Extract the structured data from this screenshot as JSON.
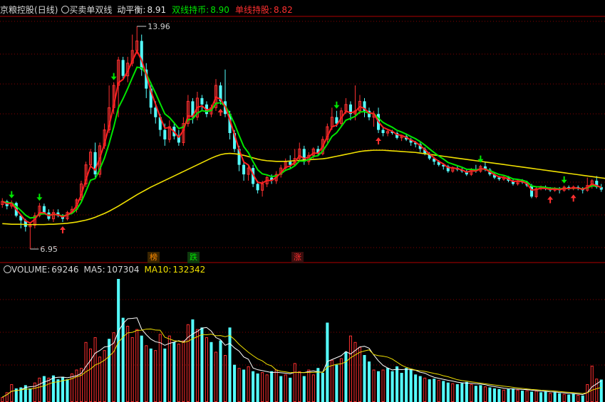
{
  "main_panel": {
    "stock_name": "京粮控股",
    "period": "(日线)",
    "indicator_name": "买卖单双线",
    "items": [
      {
        "label": "动平衡:",
        "value": "8.91",
        "label_color": "#e6e6e6",
        "value_color": "#e6e6e6"
      },
      {
        "label": "双线持币:",
        "value": "8.90",
        "label_color": "#00e600",
        "value_color": "#00e600"
      },
      {
        "label": "单线持股:",
        "value": "8.82",
        "label_color": "#ff3030",
        "value_color": "#ff3030"
      }
    ],
    "high_label": "13.96",
    "low_label": "6.95"
  },
  "badges": [
    {
      "text": "榜",
      "color": "#ff8c00",
      "bg": "#3a2400"
    },
    {
      "text": "跌",
      "color": "#00e600",
      "bg": "#0d3a0d"
    },
    {
      "text": "涨",
      "color": "#ff3030",
      "bg": "#3a0d0d"
    }
  ],
  "volume_panel": {
    "items": [
      {
        "label": "VOLUME:",
        "value": "69246",
        "color": "#d6d6d6"
      },
      {
        "label": "MA5:",
        "value": "107304",
        "color": "#d6d6d6"
      },
      {
        "label": "MA10:",
        "value": "132342",
        "color": "#f0e000"
      }
    ]
  },
  "colors": {
    "up": "#ff3030",
    "down": "#54ffff",
    "dual": "#00e600",
    "single": "#ff2020",
    "balance": "#f0e000",
    "grid": "#8a0000"
  },
  "chart_data": {
    "type": "candlestick",
    "price_range": [
      6.95,
      13.96
    ],
    "candles": [
      [
        8.35,
        8.45,
        8.55,
        8.25
      ],
      [
        8.45,
        8.3,
        8.5,
        8.2
      ],
      [
        8.3,
        8.4,
        8.48,
        8.22
      ],
      [
        8.4,
        8.0,
        8.44,
        7.95
      ],
      [
        8.0,
        7.85,
        8.05,
        7.6
      ],
      [
        7.85,
        7.65,
        7.9,
        7.5
      ],
      [
        7.65,
        7.7,
        7.8,
        6.95
      ],
      [
        7.7,
        8.0,
        8.1,
        7.6
      ],
      [
        8.0,
        8.3,
        8.4,
        7.95
      ],
      [
        8.3,
        8.1,
        8.38,
        8.05
      ],
      [
        8.1,
        7.9,
        8.2,
        7.85
      ],
      [
        7.9,
        8.1,
        8.2,
        7.8
      ],
      [
        8.1,
        8.0,
        8.2,
        7.95
      ],
      [
        8.0,
        7.9,
        8.05,
        7.8
      ],
      [
        7.9,
        8.1,
        8.15,
        7.85
      ],
      [
        8.1,
        8.2,
        8.3,
        8.05
      ],
      [
        8.2,
        8.5,
        8.55,
        8.1
      ],
      [
        8.5,
        9.0,
        9.1,
        8.4
      ],
      [
        9.0,
        9.6,
        9.7,
        8.9
      ],
      [
        9.6,
        10.0,
        10.1,
        9.5
      ],
      [
        10.0,
        9.3,
        10.3,
        9.2
      ],
      [
        9.3,
        10.2,
        10.3,
        9.2
      ],
      [
        10.2,
        10.7,
        10.9,
        10.1
      ],
      [
        10.7,
        11.4,
        12.1,
        10.6
      ],
      [
        11.4,
        12.1,
        12.2,
        11.2
      ],
      [
        12.1,
        12.9,
        13.0,
        11.1
      ],
      [
        12.9,
        12.4,
        13.0,
        12.3
      ],
      [
        12.4,
        12.8,
        13.0,
        12.2
      ],
      [
        12.8,
        13.2,
        13.7,
        12.7
      ],
      [
        13.2,
        13.5,
        13.96,
        13.1
      ],
      [
        13.5,
        12.6,
        13.7,
        12.4
      ],
      [
        12.6,
        12.0,
        12.8,
        11.7
      ],
      [
        12.0,
        11.4,
        12.2,
        11.2
      ],
      [
        11.4,
        11.1,
        11.6,
        10.9
      ],
      [
        11.1,
        10.7,
        11.2,
        10.5
      ],
      [
        10.7,
        10.4,
        10.9,
        10.2
      ],
      [
        10.4,
        10.8,
        11.0,
        10.3
      ],
      [
        10.8,
        10.5,
        10.9,
        10.4
      ],
      [
        10.5,
        10.3,
        10.7,
        10.2
      ],
      [
        10.3,
        10.9,
        11.1,
        10.2
      ],
      [
        10.9,
        11.6,
        11.8,
        10.8
      ],
      [
        11.6,
        11.1,
        11.7,
        10.9
      ],
      [
        11.1,
        11.7,
        11.9,
        11.0
      ],
      [
        11.7,
        11.5,
        11.8,
        11.3
      ],
      [
        11.5,
        11.2,
        11.6,
        11.1
      ],
      [
        11.2,
        11.4,
        11.5,
        11.1
      ],
      [
        11.4,
        12.1,
        12.3,
        11.3
      ],
      [
        12.1,
        11.6,
        12.2,
        11.5
      ],
      [
        11.6,
        11.2,
        12.6,
        11.1
      ],
      [
        11.2,
        10.6,
        11.3,
        10.4
      ],
      [
        10.6,
        10.1,
        10.7,
        10.0
      ],
      [
        10.1,
        9.6,
        10.2,
        9.4
      ],
      [
        9.6,
        9.3,
        9.7,
        9.1
      ],
      [
        9.3,
        9.5,
        9.6,
        9.1
      ],
      [
        9.5,
        9.0,
        9.6,
        8.9
      ],
      [
        9.0,
        8.8,
        9.1,
        8.7
      ],
      [
        8.8,
        9.0,
        9.1,
        8.6
      ],
      [
        9.0,
        9.2,
        9.25,
        8.9
      ],
      [
        9.2,
        9.1,
        9.3,
        9.0
      ],
      [
        9.1,
        9.3,
        9.4,
        9.0
      ],
      [
        9.3,
        9.5,
        9.6,
        9.2
      ],
      [
        9.5,
        9.7,
        9.8,
        9.4
      ],
      [
        9.7,
        9.6,
        9.9,
        9.5
      ],
      [
        9.6,
        9.8,
        10.1,
        9.55
      ],
      [
        9.8,
        10.1,
        10.3,
        9.7
      ],
      [
        10.1,
        9.7,
        10.2,
        9.6
      ],
      [
        9.7,
        9.9,
        10.0,
        9.6
      ],
      [
        9.9,
        10.1,
        10.15,
        9.8
      ],
      [
        10.1,
        9.95,
        10.2,
        9.9
      ],
      [
        9.95,
        10.4,
        10.5,
        9.9
      ],
      [
        10.4,
        10.8,
        10.9,
        10.3
      ],
      [
        10.8,
        11.1,
        11.4,
        10.7
      ],
      [
        11.1,
        10.9,
        11.3,
        10.8
      ],
      [
        10.9,
        11.3,
        11.4,
        10.8
      ],
      [
        11.3,
        11.5,
        11.7,
        11.2
      ],
      [
        11.5,
        11.2,
        11.6,
        11.0
      ],
      [
        11.2,
        11.3,
        12.1,
        11.0
      ],
      [
        11.3,
        11.6,
        11.8,
        11.2
      ],
      [
        11.6,
        11.3,
        11.7,
        11.1
      ],
      [
        11.3,
        11.1,
        11.4,
        11.0
      ],
      [
        11.1,
        11.2,
        11.3,
        10.8
      ],
      [
        11.2,
        10.7,
        11.4,
        10.6
      ],
      [
        10.7,
        10.6,
        10.8,
        10.5
      ],
      [
        10.6,
        10.65,
        10.7,
        10.5
      ],
      [
        10.65,
        10.6,
        10.7,
        10.55
      ],
      [
        10.6,
        10.45,
        10.65,
        10.4
      ],
      [
        10.45,
        10.5,
        10.55,
        10.35
      ],
      [
        10.5,
        10.4,
        10.55,
        10.35
      ],
      [
        10.4,
        10.3,
        10.45,
        10.2
      ],
      [
        10.3,
        10.25,
        10.35,
        10.15
      ],
      [
        10.25,
        10.1,
        10.3,
        10.0
      ],
      [
        10.1,
        9.95,
        10.15,
        9.9
      ],
      [
        9.95,
        9.8,
        10.0,
        9.75
      ],
      [
        9.8,
        9.7,
        9.85,
        9.6
      ],
      [
        9.7,
        9.6,
        9.75,
        9.55
      ],
      [
        9.6,
        9.55,
        9.65,
        9.45
      ],
      [
        9.55,
        9.4,
        9.6,
        9.35
      ],
      [
        9.4,
        9.5,
        9.55,
        9.35
      ],
      [
        9.5,
        9.45,
        9.55,
        9.4
      ],
      [
        9.45,
        9.4,
        9.5,
        9.35
      ],
      [
        9.4,
        9.3,
        9.45,
        9.25
      ],
      [
        9.3,
        9.45,
        9.5,
        9.25
      ],
      [
        9.45,
        9.4,
        9.6,
        9.35
      ],
      [
        9.4,
        9.55,
        9.6,
        9.35
      ],
      [
        9.55,
        9.45,
        9.7,
        9.4
      ],
      [
        9.45,
        9.3,
        9.5,
        9.25
      ],
      [
        9.3,
        9.2,
        9.35,
        9.15
      ],
      [
        9.2,
        9.15,
        9.25,
        9.1
      ],
      [
        9.15,
        9.2,
        9.25,
        9.1
      ],
      [
        9.2,
        9.1,
        9.25,
        9.05
      ],
      [
        9.1,
        9.0,
        9.15,
        8.95
      ],
      [
        9.0,
        9.1,
        9.15,
        8.95
      ],
      [
        9.1,
        9.05,
        9.15,
        9.0
      ],
      [
        9.05,
        8.95,
        9.1,
        8.9
      ],
      [
        8.95,
        8.6,
        9.0,
        8.55
      ],
      [
        8.6,
        8.85,
        8.9,
        8.55
      ],
      [
        8.85,
        8.9,
        8.95,
        8.8
      ],
      [
        8.9,
        8.85,
        8.95,
        8.8
      ],
      [
        8.85,
        8.8,
        8.9,
        8.75
      ],
      [
        8.8,
        8.85,
        8.9,
        8.75
      ],
      [
        8.85,
        8.8,
        8.9,
        8.7
      ],
      [
        8.8,
        8.9,
        8.95,
        8.75
      ],
      [
        8.9,
        8.85,
        8.95,
        8.8
      ],
      [
        8.85,
        8.9,
        8.95,
        8.8
      ],
      [
        8.9,
        8.85,
        8.95,
        8.8
      ],
      [
        8.85,
        8.8,
        8.9,
        8.7
      ],
      [
        8.8,
        8.95,
        9.2,
        8.75
      ],
      [
        8.95,
        9.1,
        9.15,
        8.85
      ],
      [
        9.1,
        8.9,
        9.25,
        8.85
      ],
      [
        8.9,
        8.82,
        9.0,
        8.75
      ]
    ],
    "balance_line": [
      7.75,
      7.74,
      7.73,
      7.73,
      7.73,
      7.72,
      7.72,
      7.72,
      7.72,
      7.72,
      7.73,
      7.73,
      7.74,
      7.75,
      7.76,
      7.78,
      7.8,
      7.83,
      7.86,
      7.9,
      7.95,
      8.01,
      8.07,
      8.14,
      8.22,
      8.3,
      8.39,
      8.48,
      8.57,
      8.66,
      8.74,
      8.82,
      8.9,
      8.97,
      9.04,
      9.11,
      9.18,
      9.25,
      9.32,
      9.39,
      9.46,
      9.53,
      9.6,
      9.67,
      9.74,
      9.81,
      9.87,
      9.92,
      9.95,
      9.96,
      9.95,
      9.93,
      9.9,
      9.86,
      9.82,
      9.78,
      9.75,
      9.73,
      9.72,
      9.71,
      9.71,
      9.71,
      9.72,
      9.73,
      9.74,
      9.75,
      9.76,
      9.77,
      9.78,
      9.79,
      9.81,
      9.84,
      9.87,
      9.9,
      9.93,
      9.96,
      9.99,
      10.02,
      10.04,
      10.05,
      10.06,
      10.06,
      10.06,
      10.05,
      10.04,
      10.03,
      10.02,
      10.01,
      10.0,
      9.99,
      9.97,
      9.95,
      9.93,
      9.91,
      9.89,
      9.87,
      9.85,
      9.83,
      9.81,
      9.79,
      9.77,
      9.75,
      9.73,
      9.71,
      9.69,
      9.67,
      9.65,
      9.63,
      9.61,
      9.59,
      9.57,
      9.55,
      9.53,
      9.51,
      9.49,
      9.47,
      9.45,
      9.43,
      9.41,
      9.39,
      9.37,
      9.35,
      9.33,
      9.31,
      9.29,
      9.27,
      9.25,
      9.23,
      9.21,
      9.19,
      9.17,
      9.15,
      9.13,
      9.11
    ],
    "volume_max": 380000,
    "volume": [
      [
        15000,
        0
      ],
      [
        30000,
        0
      ],
      [
        55000,
        0
      ],
      [
        42000,
        1
      ],
      [
        45000,
        1
      ],
      [
        52000,
        1
      ],
      [
        42000,
        1
      ],
      [
        60000,
        0
      ],
      [
        75000,
        0
      ],
      [
        80000,
        1
      ],
      [
        75000,
        0
      ],
      [
        82000,
        1
      ],
      [
        70000,
        1
      ],
      [
        78000,
        1
      ],
      [
        70000,
        1
      ],
      [
        88000,
        0
      ],
      [
        100000,
        0
      ],
      [
        105000,
        0
      ],
      [
        185000,
        0
      ],
      [
        165000,
        0
      ],
      [
        200000,
        0
      ],
      [
        140000,
        0
      ],
      [
        160000,
        0
      ],
      [
        195000,
        1
      ],
      [
        215000,
        0
      ],
      [
        380000,
        1
      ],
      [
        260000,
        1
      ],
      [
        235000,
        0
      ],
      [
        200000,
        0
      ],
      [
        225000,
        0
      ],
      [
        205000,
        1
      ],
      [
        175000,
        0
      ],
      [
        165000,
        1
      ],
      [
        160000,
        0
      ],
      [
        210000,
        0
      ],
      [
        165000,
        1
      ],
      [
        205000,
        0
      ],
      [
        185000,
        1
      ],
      [
        180000,
        0
      ],
      [
        190000,
        0
      ],
      [
        240000,
        0
      ],
      [
        255000,
        1
      ],
      [
        225000,
        0
      ],
      [
        230000,
        1
      ],
      [
        200000,
        0
      ],
      [
        185000,
        1
      ],
      [
        155000,
        0
      ],
      [
        190000,
        1
      ],
      [
        145000,
        0
      ],
      [
        230000,
        1
      ],
      [
        115000,
        1
      ],
      [
        105000,
        0
      ],
      [
        100000,
        1
      ],
      [
        110000,
        0
      ],
      [
        95000,
        1
      ],
      [
        88000,
        1
      ],
      [
        92000,
        0
      ],
      [
        85000,
        0
      ],
      [
        95000,
        1
      ],
      [
        100000,
        0
      ],
      [
        80000,
        1
      ],
      [
        85000,
        0
      ],
      [
        75000,
        1
      ],
      [
        120000,
        0
      ],
      [
        95000,
        0
      ],
      [
        80000,
        1
      ],
      [
        100000,
        0
      ],
      [
        85000,
        0
      ],
      [
        105000,
        1
      ],
      [
        90000,
        1
      ],
      [
        245000,
        1
      ],
      [
        130000,
        0
      ],
      [
        115000,
        1
      ],
      [
        135000,
        0
      ],
      [
        155000,
        1
      ],
      [
        205000,
        0
      ],
      [
        185000,
        0
      ],
      [
        170000,
        0
      ],
      [
        145000,
        1
      ],
      [
        125000,
        1
      ],
      [
        100000,
        0
      ],
      [
        95000,
        1
      ],
      [
        100000,
        0
      ],
      [
        105000,
        1
      ],
      [
        95000,
        1
      ],
      [
        110000,
        1
      ],
      [
        90000,
        1
      ],
      [
        105000,
        1
      ],
      [
        100000,
        1
      ],
      [
        85000,
        1
      ],
      [
        80000,
        1
      ],
      [
        75000,
        0
      ],
      [
        70000,
        1
      ],
      [
        72000,
        1
      ],
      [
        68000,
        0
      ],
      [
        65000,
        1
      ],
      [
        60000,
        1
      ],
      [
        58000,
        0
      ],
      [
        55000,
        1
      ],
      [
        58000,
        1
      ],
      [
        62000,
        1
      ],
      [
        55000,
        0
      ],
      [
        50000,
        1
      ],
      [
        52000,
        1
      ],
      [
        48000,
        0
      ],
      [
        45000,
        1
      ],
      [
        42000,
        1
      ],
      [
        40000,
        1
      ],
      [
        38000,
        0
      ],
      [
        40000,
        1
      ],
      [
        42000,
        1
      ],
      [
        38000,
        0
      ],
      [
        35000,
        1
      ],
      [
        36000,
        0
      ],
      [
        32000,
        1
      ],
      [
        35000,
        0
      ],
      [
        30000,
        1
      ],
      [
        32000,
        1
      ],
      [
        28000,
        0
      ],
      [
        30000,
        1
      ],
      [
        27000,
        1
      ],
      [
        25000,
        0
      ],
      [
        23000,
        1
      ],
      [
        25000,
        1
      ],
      [
        22000,
        0
      ],
      [
        20000,
        1
      ],
      [
        55000,
        0
      ],
      [
        112000,
        0
      ],
      [
        72000,
        0
      ],
      [
        69246,
        1
      ]
    ]
  }
}
